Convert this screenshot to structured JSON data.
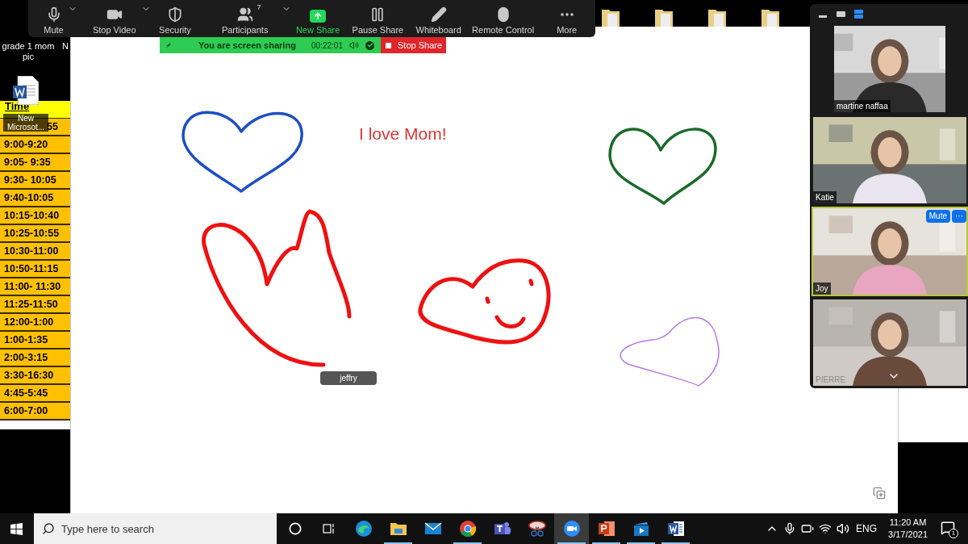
{
  "desktop": {
    "icons": [
      {
        "label": "grade 1 mom pic"
      },
      {
        "label": "N"
      },
      {
        "label": "New Microsot..."
      }
    ]
  },
  "schedule": {
    "header": "Time",
    "rows": [
      "55",
      "9:00-9:20",
      "9:05- 9:35",
      "9:30- 10:05",
      "9:40-10:05",
      "10:15-10:40",
      "10:25-10:55",
      "10:30-11:00",
      "10:50-11:15",
      "11:00- 11:30",
      "11:25-11:50",
      "12:00-1:00",
      "1:00-1:35",
      "2:00-3:15",
      "3:30-16:30",
      "4:45-5:45",
      "6:00-7:00"
    ]
  },
  "meeting_toolbar": {
    "items": [
      {
        "kind": "mute",
        "label": "Mute",
        "caret": true
      },
      {
        "kind": "video",
        "label": "Stop Video",
        "caret": true
      },
      {
        "kind": "security",
        "label": "Security",
        "caret": false
      },
      {
        "kind": "participants",
        "label": "Participants",
        "count": "7",
        "caret": true
      },
      {
        "kind": "new-share",
        "label": "New Share",
        "caret": false
      },
      {
        "kind": "pause",
        "label": "Pause Share",
        "caret": false
      },
      {
        "kind": "whiteboard",
        "label": "Whiteboard",
        "caret": false
      },
      {
        "kind": "remote",
        "label": "Remote Control",
        "caret": false
      },
      {
        "kind": "more",
        "label": "More",
        "caret": false
      }
    ]
  },
  "share_banner": {
    "message": "You are screen sharing",
    "timer": "00:22:01",
    "stop": "Stop Share"
  },
  "whiteboard": {
    "text": "I love Mom!",
    "annotator": "jeffry",
    "strokes": [
      {
        "color": "#1d4fc4"
      },
      {
        "color": "#1a6b2a"
      },
      {
        "color": "#ee1111"
      },
      {
        "color": "#ee1111"
      },
      {
        "color": "#b57ae8"
      }
    ]
  },
  "gallery": {
    "views": [
      {
        "kind": "minimize",
        "selected": false
      },
      {
        "kind": "speaker",
        "selected": false
      },
      {
        "kind": "gallery",
        "selected": true
      }
    ],
    "tiles": [
      {
        "name": "martine naffaa",
        "speaking": false
      },
      {
        "name": "Katie",
        "speaking": false
      },
      {
        "name": "Joy",
        "speaking": true,
        "actions": [
          "Mute",
          "···"
        ]
      },
      {
        "name": "PIERRE",
        "speaking": false
      }
    ]
  },
  "taskbar": {
    "search_placeholder": "Type here to search",
    "apps": [
      {
        "kind": "edge",
        "running": false,
        "selected": false
      },
      {
        "kind": "explorer",
        "running": true,
        "selected": false
      },
      {
        "kind": "mail",
        "running": false,
        "selected": false
      },
      {
        "kind": "chrome",
        "running": true,
        "selected": false
      },
      {
        "kind": "teams",
        "running": false,
        "selected": false
      },
      {
        "kind": "snip",
        "running": false,
        "selected": false
      },
      {
        "kind": "zoom",
        "running": true,
        "selected": true
      },
      {
        "kind": "powerpoint",
        "running": true,
        "selected": false
      },
      {
        "kind": "movies",
        "running": true,
        "selected": false
      },
      {
        "kind": "word",
        "running": true,
        "selected": false
      }
    ],
    "tray": {
      "language": "ENG",
      "time": "11:20 AM",
      "date": "3/17/2021",
      "notifications": "1"
    }
  }
}
